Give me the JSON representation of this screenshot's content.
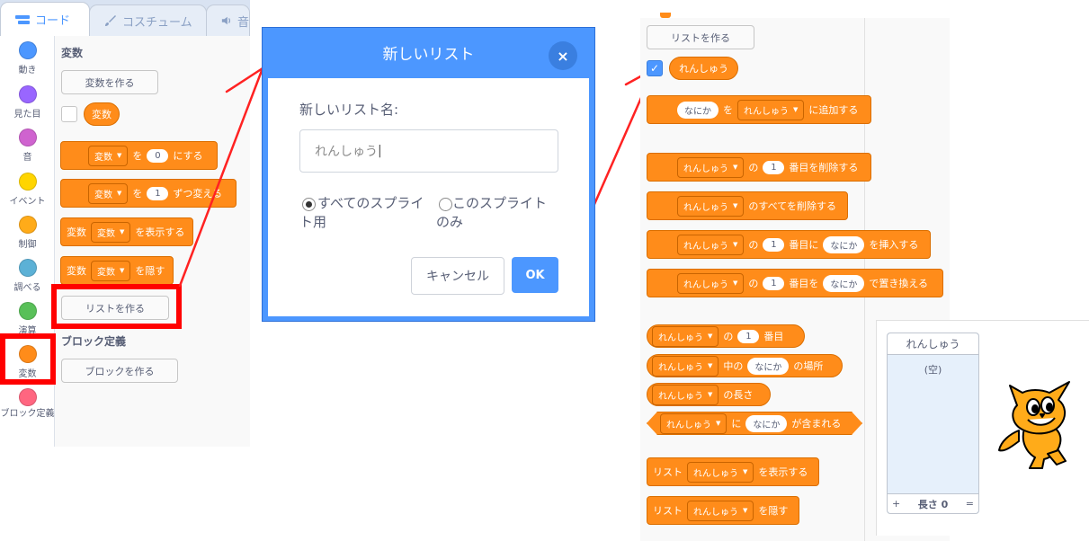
{
  "tabs": [
    {
      "label": "コード",
      "icon": "code-icon"
    },
    {
      "label": "コスチューム",
      "icon": "brush-icon"
    },
    {
      "label": "音",
      "icon": "speaker-icon"
    }
  ],
  "categories": [
    {
      "label": "動き",
      "color": "#4c97ff"
    },
    {
      "label": "見た目",
      "color": "#9966ff"
    },
    {
      "label": "音",
      "color": "#cf63cf"
    },
    {
      "label": "イベント",
      "color": "#ffd500"
    },
    {
      "label": "制御",
      "color": "#ffab19"
    },
    {
      "label": "調べる",
      "color": "#5cb1d6"
    },
    {
      "label": "演算",
      "color": "#59c059"
    },
    {
      "label": "変数",
      "color": "#ff8c1a"
    },
    {
      "label": "ブロック定義",
      "color": "#ff6680"
    }
  ],
  "palette": {
    "section_variables": "変数",
    "make_variable": "変数を作る",
    "var_reporter": "変数",
    "set_block": {
      "var": "変数",
      "to": "を",
      "value": "0",
      "suffix": "にする"
    },
    "change_block": {
      "var": "変数",
      "by": "を",
      "value": "1",
      "suffix": "ずつ変える"
    },
    "show_block": {
      "prefix": "変数",
      "var": "変数",
      "suffix": "を表示する"
    },
    "hide_block": {
      "prefix": "変数",
      "var": "変数",
      "suffix": "を隠す"
    },
    "make_list": "リストを作る",
    "section_my_blocks": "ブロック定義",
    "make_block": "ブロックを作る"
  },
  "dialog": {
    "title": "新しいリスト",
    "close_glyph": "×",
    "label": "新しいリスト名:",
    "input_value": "れんしゅう",
    "radio_all_line1": "すべてのスプライ",
    "radio_all_line2": "ト用",
    "radio_this_line1": "このスプライト",
    "radio_this_line2": "のみ",
    "cancel": "キャンセル",
    "ok": "OK"
  },
  "list_palette": {
    "make_list": "リストを作る",
    "list_name": "れんしゅう",
    "add": {
      "item": "なにか",
      "wo": "を",
      "suffix": "に追加する"
    },
    "delete": {
      "no": "の",
      "index": "1",
      "suffix": "番目を削除する"
    },
    "delete_all": {
      "suffix": "のすべてを削除する"
    },
    "insert": {
      "no": "の",
      "index": "1",
      "mid": "番目に",
      "item": "なにか",
      "suffix": "を挿入する"
    },
    "replace": {
      "no": "の",
      "index": "1",
      "mid": "番目を",
      "item": "なにか",
      "suffix": "で置き換える"
    },
    "item_of": {
      "no": "の",
      "index": "1",
      "suffix": "番目"
    },
    "index_of": {
      "mid": "中の",
      "item": "なにか",
      "suffix": "の場所"
    },
    "length": {
      "suffix": "の長さ"
    },
    "contains": {
      "ni": "に",
      "item": "なにか",
      "suffix": "が含まれる"
    },
    "show_list": {
      "prefix": "リスト",
      "suffix": "を表示する"
    },
    "hide_list": {
      "prefix": "リスト",
      "suffix": "を隠す"
    }
  },
  "stage": {
    "monitor_title": "れんしゅう",
    "monitor_empty": "(空)",
    "monitor_plus": "+",
    "monitor_length": "長さ 0",
    "monitor_resize": "="
  }
}
